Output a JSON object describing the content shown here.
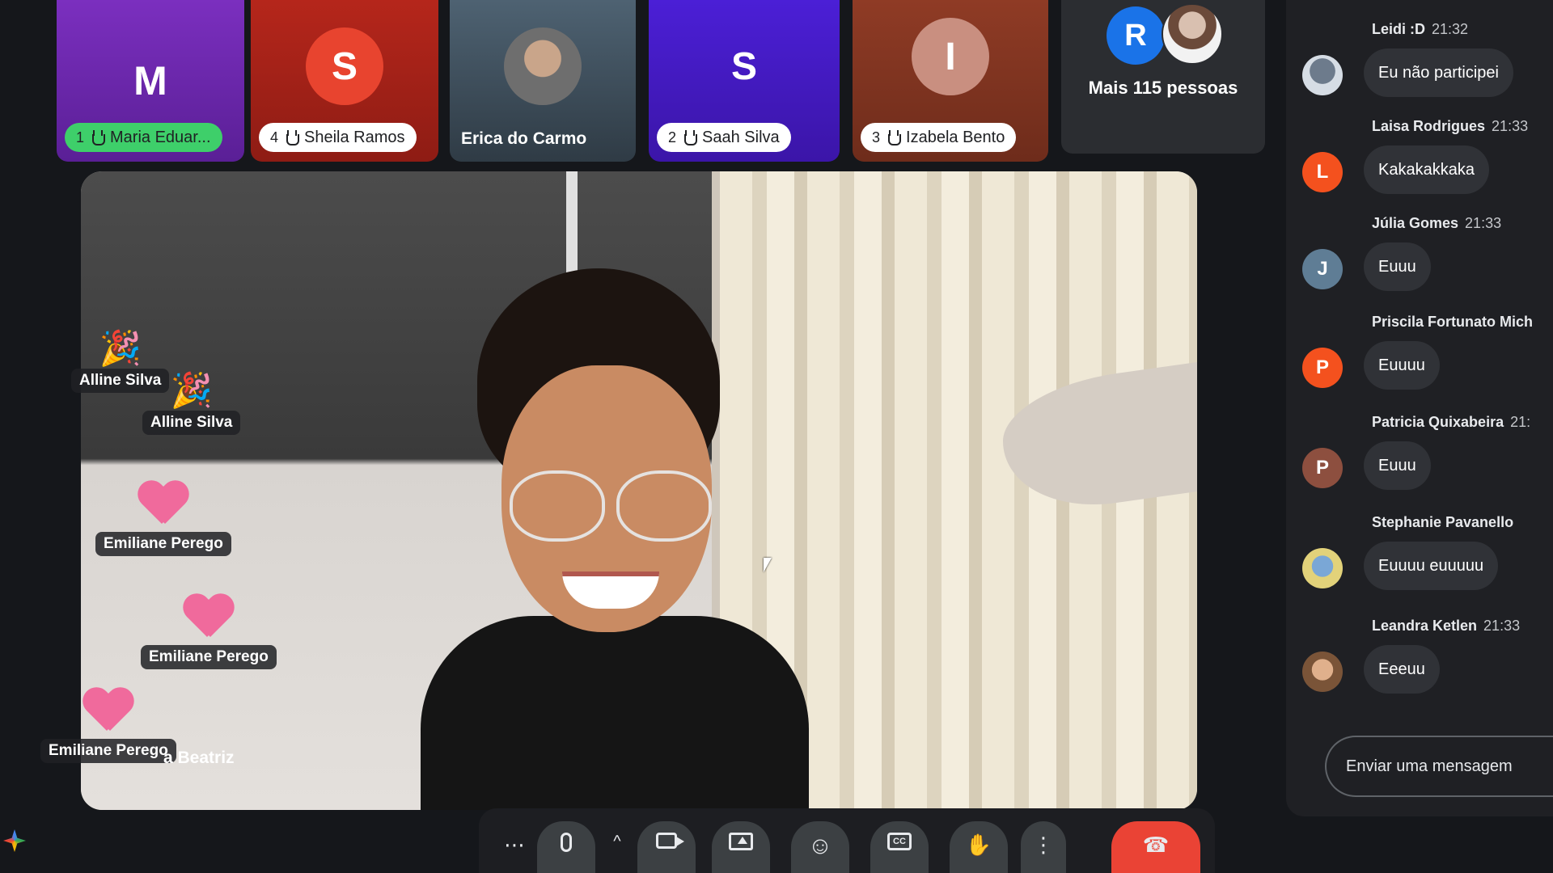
{
  "colors": {
    "tile_maria": "#7b2fbf",
    "tile_sheila": "#b5261b",
    "tile_erica": "#4e6272",
    "tile_saah": "#4b1fd6",
    "tile_izabela": "#8f3b25",
    "avatar_sheila": "#e8442f",
    "avatar_izabela": "#c98f80",
    "pill_maria": "#3ecf6a",
    "end_call": "#ea4335",
    "avatar_r": "#1a73e8",
    "avatar_l": "#f4511e",
    "avatar_j": "#5f7d95",
    "avatar_p1": "#f4511e",
    "avatar_p2": "#8d4f3f"
  },
  "participants": [
    {
      "initial": "M",
      "name": "Maria Eduar...",
      "hand_order": "1"
    },
    {
      "initial": "S",
      "name": "Sheila Ramos",
      "hand_order": "4"
    },
    {
      "initial": "",
      "name": "Erica do Carmo",
      "hand_order": ""
    },
    {
      "initial": "S",
      "name": "Saah Silva",
      "hand_order": "2"
    },
    {
      "initial": "I",
      "name": "Izabela Bento",
      "hand_order": "3"
    }
  ],
  "more_people": {
    "initial": "R",
    "label": "Mais 115 pessoas"
  },
  "main_video": {
    "name_partial": "a Beatriz"
  },
  "reactions": [
    {
      "emoji": "🎉",
      "name": "Alline Silva"
    },
    {
      "emoji": "🎉",
      "name": "Alline Silva"
    },
    {
      "emoji": "heart",
      "name": "Emiliane Perego"
    },
    {
      "emoji": "heart",
      "name": "Emiliane Perego"
    },
    {
      "emoji": "heart",
      "name": "Emiliane Perego"
    }
  ],
  "chat": {
    "messages": [
      {
        "initial": "",
        "author": "Leidi :D",
        "time": "21:32",
        "text": "Eu não participei"
      },
      {
        "initial": "L",
        "author": "Laisa Rodrigues",
        "time": "21:33",
        "text": "Kakakakkaka"
      },
      {
        "initial": "J",
        "author": "Júlia Gomes",
        "time": "21:33",
        "text": "Euuu"
      },
      {
        "initial": "P",
        "author": "Priscila Fortunato Mich",
        "time": "",
        "text": "Euuuu"
      },
      {
        "initial": "P",
        "author": "Patricia Quixabeira",
        "time": "21:",
        "text": "Euuu"
      },
      {
        "initial": "",
        "author": "Stephanie Pavanello",
        "time": "",
        "text": "Euuuu euuuuu"
      },
      {
        "initial": "",
        "author": "Leandra Ketlen",
        "time": "21:33",
        "text": "Eeeuu"
      }
    ],
    "input_placeholder": "Enviar uma mensagem"
  },
  "toolbar": {
    "more_options": "⋯",
    "expand": "^",
    "more_vert": "⋮",
    "emoji": "☺",
    "raise_hand": "✋",
    "end_call": "☎"
  }
}
